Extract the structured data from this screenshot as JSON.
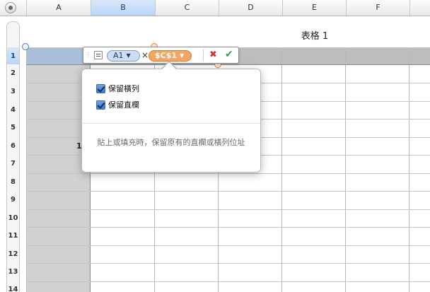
{
  "sheet": {
    "columns": [
      "A",
      "B",
      "C",
      "D",
      "E",
      "F"
    ],
    "rows": [
      "1",
      "2",
      "3",
      "4",
      "5",
      "6",
      "7",
      "8",
      "9",
      "10",
      "11",
      "12",
      "13",
      "14"
    ],
    "table_title": "表格 1",
    "cell_a6_value": "1"
  },
  "formula": {
    "token_a1": "A1",
    "operator": "×",
    "token_c1": "$C$1",
    "cancel_glyph": "✖",
    "accept_glyph": "✔"
  },
  "popover": {
    "option_preserve_row": "保留橫列",
    "option_preserve_column": "保留直欄",
    "description": "貼上或填充時，保留原有的直欄或橫列位址"
  },
  "colors": {
    "selection_blue": "#bcd5f5",
    "reference_orange": "#f2a665",
    "header_gray": "#bdbdbd"
  }
}
